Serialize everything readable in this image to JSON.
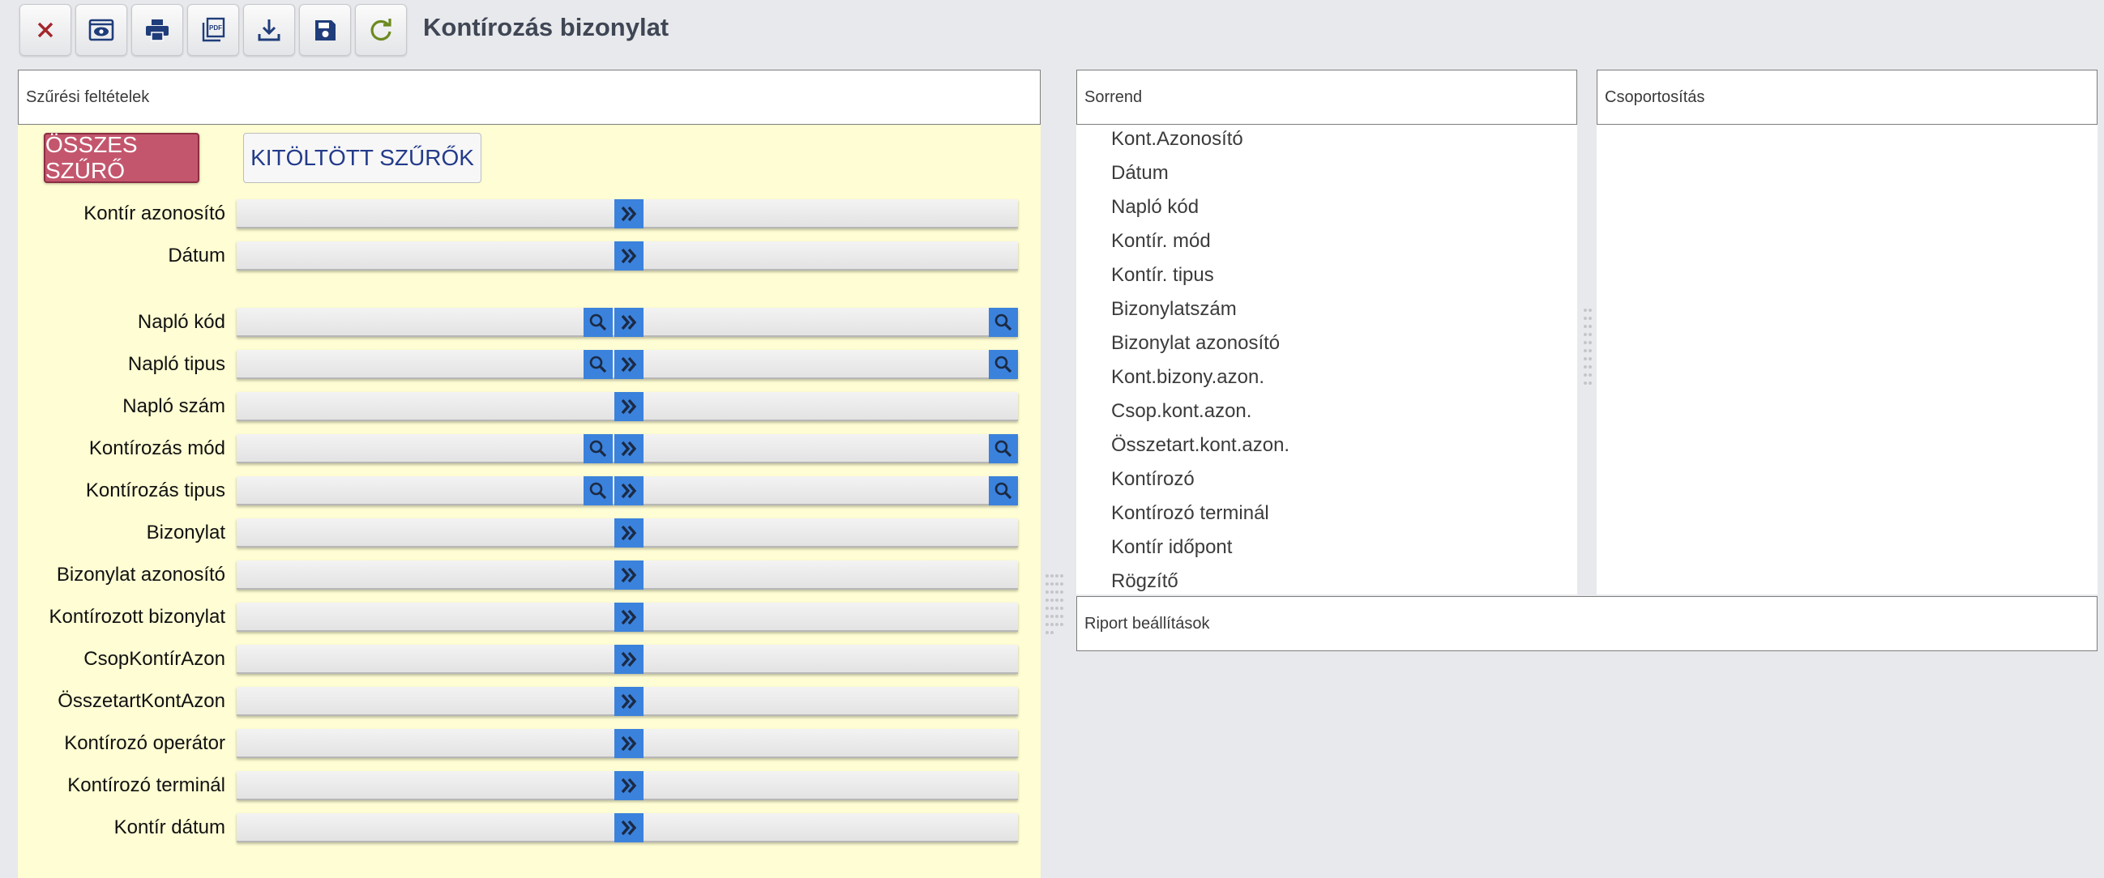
{
  "title": "Kontírozás bizonylat",
  "toolbar": [
    {
      "name": "close-button",
      "icon": "close-icon"
    },
    {
      "name": "preview-button",
      "icon": "eye-icon"
    },
    {
      "name": "print-button",
      "icon": "printer-icon"
    },
    {
      "name": "pdf-button",
      "icon": "pdf-icon"
    },
    {
      "name": "download-button",
      "icon": "download-icon"
    },
    {
      "name": "save-button",
      "icon": "save-icon"
    },
    {
      "name": "refresh-button",
      "icon": "refresh-icon"
    }
  ],
  "panels": {
    "filters": "Szűrési feltételek",
    "order": "Sorrend",
    "grouping": "Csoportosítás",
    "report_settings": "Riport beállítások"
  },
  "tabs": {
    "all": "ÖSSZES SZŰRŐ",
    "filled": "KITÖLTÖTT SZŰRŐK"
  },
  "filters": [
    {
      "label": "Kontír azonosító",
      "search": false
    },
    {
      "label": "Dátum",
      "search": false
    },
    {
      "label": "Napló kód",
      "search": true
    },
    {
      "label": "Napló tipus",
      "search": true
    },
    {
      "label": "Napló szám",
      "search": false
    },
    {
      "label": "Kontírozás mód",
      "search": true
    },
    {
      "label": "Kontírozás tipus",
      "search": true
    },
    {
      "label": "Bizonylat",
      "search": false
    },
    {
      "label": "Bizonylat azonosító",
      "search": false
    },
    {
      "label": "Kontírozott bizonylat",
      "search": false
    },
    {
      "label": "CsopKontírAzon",
      "search": false
    },
    {
      "label": "ÖsszetartKontAzon",
      "search": false
    },
    {
      "label": "Kontírozó operátor",
      "search": false
    },
    {
      "label": "Kontírozó terminál",
      "search": false
    },
    {
      "label": "Kontír dátum",
      "search": false
    }
  ],
  "sort_items": [
    "Kont.Azonosító",
    "Dátum",
    "Napló kód",
    "Kontír. mód",
    "Kontír. tipus",
    "Bizonylatszám",
    "Bizonylat azonosító",
    "Kont.bizony.azon.",
    "Csop.kont.azon.",
    "Összetart.kont.azon.",
    "Kontírozó",
    "Kontírozó terminál",
    "Kontír időpont",
    "Rögzítő"
  ],
  "colors": {
    "accent_blue": "#3b82dc",
    "tab_active": "#c3566d",
    "filter_bg": "#fefdd3",
    "title": "#3f4654"
  }
}
